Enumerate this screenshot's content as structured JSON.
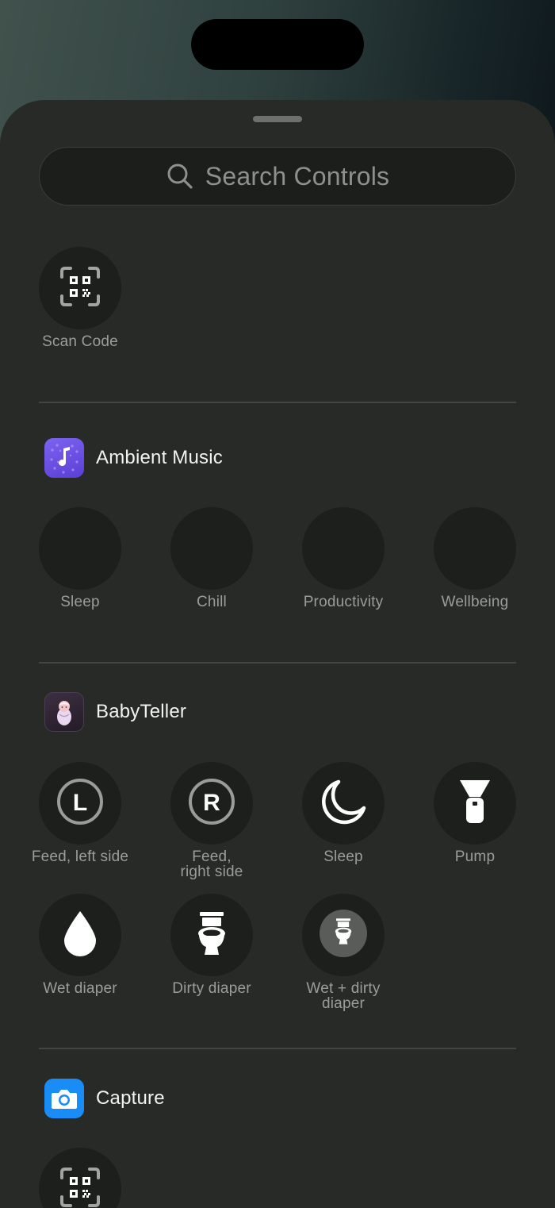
{
  "search": {
    "placeholder": "Search Controls"
  },
  "top_controls": [
    {
      "label": "Scan Code",
      "icon": "qr-scan-icon"
    }
  ],
  "sections": [
    {
      "title": "Ambient Music",
      "app_icon": "ambient-music-app-icon",
      "accent": "#6f56e6",
      "controls": [
        {
          "label": "Sleep"
        },
        {
          "label": "Chill"
        },
        {
          "label": "Productivity"
        },
        {
          "label": "Wellbeing"
        }
      ]
    },
    {
      "title": "BabyTeller",
      "app_icon": "babyteller-app-icon",
      "controls": [
        {
          "label": "Feed, left side",
          "icon": "feed-left-icon",
          "glyph": "L"
        },
        {
          "label": "Feed,\nright side",
          "icon": "feed-right-icon",
          "glyph": "R"
        },
        {
          "label": "Sleep",
          "icon": "moon-icon"
        },
        {
          "label": "Pump",
          "icon": "breast-pump-icon"
        },
        {
          "label": "Wet diaper",
          "icon": "water-drop-icon"
        },
        {
          "label": "Dirty diaper",
          "icon": "toilet-icon"
        },
        {
          "label": "Wet + dirty\ndiaper",
          "icon": "toilet-badge-icon"
        }
      ]
    },
    {
      "title": "Capture",
      "app_icon": "camera-app-icon",
      "accent": "#1a8cf5",
      "controls": [
        {
          "icon": "qr-scan-icon"
        }
      ]
    }
  ]
}
